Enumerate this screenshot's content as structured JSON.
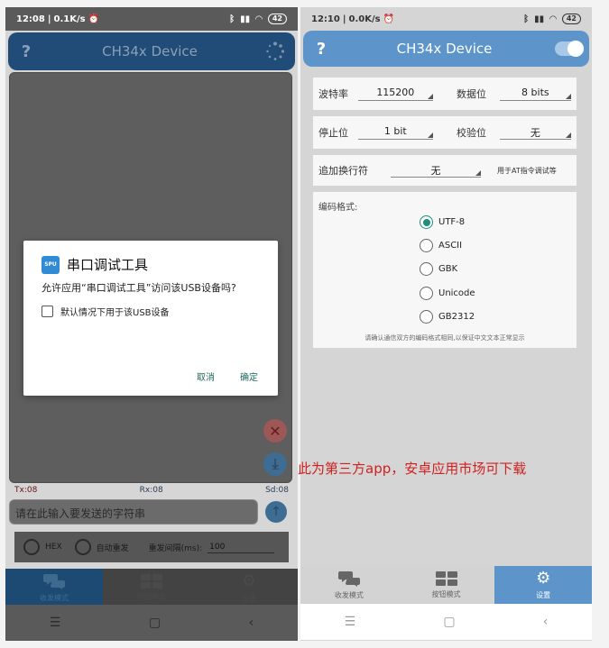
{
  "left": {
    "status": {
      "time": "12:08",
      "speed": "0.1K/s",
      "battery": "42"
    },
    "appbar": {
      "help": "?",
      "title": "CH34x Device"
    },
    "counters": {
      "tx": "Tx:08",
      "rx": "Rx:08",
      "sd": "Sd:08"
    },
    "send": {
      "placeholder": "请在此输入要发送的字符串"
    },
    "options": {
      "hex_label": "HEX",
      "auto_label": "自动重发",
      "interval_label": "重发间隔(ms):",
      "interval_value": "100"
    },
    "nav": [
      {
        "label": "收发模式"
      },
      {
        "label": "按钮模式"
      },
      {
        "label": "设置"
      }
    ],
    "dialog": {
      "icon_text": "SPU",
      "title": "串口调试工具",
      "message": "允许应用“串口调试工具”访问该USB设备吗?",
      "checkbox_label": "默认情况下用于该USB设备",
      "cancel": "取消",
      "ok": "确定"
    }
  },
  "right": {
    "status": {
      "time": "12:10",
      "speed": "0.0K/s",
      "battery": "42"
    },
    "appbar": {
      "help": "?",
      "title": "CH34x Device"
    },
    "baud": {
      "label": "波特率",
      "value": "115200"
    },
    "databits": {
      "label": "数据位",
      "value": "8 bits"
    },
    "stopbits": {
      "label": "停止位",
      "value": "1 bit"
    },
    "parity": {
      "label": "校验位",
      "value": "无"
    },
    "newline": {
      "label": "追加换行符",
      "value": "无",
      "note": "用于AT指令调试等"
    },
    "encoding": {
      "label": "编码格式:",
      "options": [
        "UTF-8",
        "ASCII",
        "GBK",
        "Unicode",
        "GB2312"
      ],
      "selected": "UTF-8",
      "hint": "请确认通信双方的编码格式相同,以保证中文文本正常显示"
    },
    "nav": [
      {
        "label": "收发模式"
      },
      {
        "label": "按钮模式"
      },
      {
        "label": "设置"
      }
    ]
  },
  "caption": "此为第三方app，安卓应用市场可下载",
  "colors": {
    "accent": "#5d95cb",
    "dark_accent": "#214c77",
    "radio_on": "#1f8d7a",
    "caption": "#d22020"
  }
}
